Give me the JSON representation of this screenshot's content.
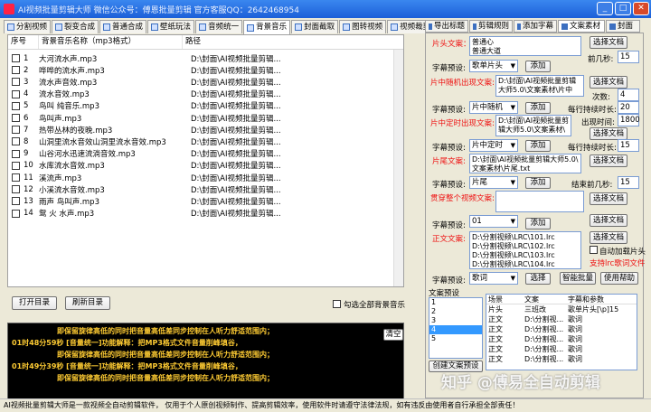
{
  "window": {
    "title": "AI视频批量剪辑大师    微信公众号：傅恩批量剪辑    官方客服QQ：2642468954"
  },
  "tabs": [
    {
      "label": "分割视频"
    },
    {
      "label": "裂变合成"
    },
    {
      "label": "普通合成"
    },
    {
      "label": "壁纸玩法"
    },
    {
      "label": "音频统一"
    },
    {
      "label": "背景音乐"
    },
    {
      "label": "封面截取"
    },
    {
      "label": "图转视频"
    },
    {
      "label": "视频裁剪"
    }
  ],
  "music_list": {
    "headers": [
      "序号",
      "背景音乐名称（mp3格式）",
      "路径"
    ],
    "rows": [
      {
        "idx": "1",
        "name": "大河流水声.mp3",
        "path": "D:\\封面\\AI视频批量剪辑..."
      },
      {
        "idx": "2",
        "name": "哗哗的流水声.mp3",
        "path": "D:\\封面\\AI视频批量剪辑..."
      },
      {
        "idx": "3",
        "name": "流水声音效.mp3",
        "path": "D:\\封面\\AI视频批量剪辑..."
      },
      {
        "idx": "4",
        "name": "流水音效.mp3",
        "path": "D:\\封面\\AI视频批量剪辑..."
      },
      {
        "idx": "5",
        "name": "鸟叫 纯音乐.mp3",
        "path": "D:\\封面\\AI视频批量剪辑..."
      },
      {
        "idx": "6",
        "name": "鸟叫声.mp3",
        "path": "D:\\封面\\AI视频批量剪辑..."
      },
      {
        "idx": "7",
        "name": "热带丛林的夜晚.mp3",
        "path": "D:\\封面\\AI视频批量剪辑..."
      },
      {
        "idx": "8",
        "name": "山洞里流水音效山洞里流水音效.mp3",
        "path": "D:\\封面\\AI视频批量剪辑..."
      },
      {
        "idx": "9",
        "name": "山谷河水迅速流淌音效.mp3",
        "path": "D:\\封面\\AI视频批量剪辑..."
      },
      {
        "idx": "10",
        "name": "水库流水音效.mp3",
        "path": "D:\\封面\\AI视频批量剪辑..."
      },
      {
        "idx": "11",
        "name": "溪流声.mp3",
        "path": "D:\\封面\\AI视频批量剪辑..."
      },
      {
        "idx": "12",
        "name": "小溪流水音效.mp3",
        "path": "D:\\封面\\AI视频批量剪辑..."
      },
      {
        "idx": "13",
        "name": "雨声 鸟叫声.mp3",
        "path": "D:\\封面\\AI视频批量剪辑..."
      },
      {
        "idx": "14",
        "name": "鸳 火 水声.mp3",
        "path": "D:\\封面\\AI视频批量剪辑..."
      }
    ]
  },
  "buttons": {
    "open_dir": "打开目录",
    "refresh_dir": "刷新目录",
    "select_all_music": "勾选全部背景音乐",
    "clear": "清空"
  },
  "console": {
    "lines": [
      "即保留旋律高低的同时把音量高低差同步控制在人听力舒适范围内；",
      "01时48分59秒 [音量统一]功能解释：把MP3格式文件音量削峰填谷，",
      "即保留旋律高低的同时把音量高低差同步控制在人听力舒适范围内；",
      "01时49分39秒 [音量统一]功能解释：把MP3格式文件音量削峰填谷，",
      "即保留旋律高低的同时把音量高低差同步控制在人听力舒适范围内；"
    ]
  },
  "status_bar": "AI视频批量剪辑大师是一款视频全自动剪辑软件，  仅用于个人原创视频制作、提高剪辑效率，使用软件时请遵守法律法规，如有违反由使用者自行承担全部责任！",
  "right_tabs": [
    {
      "label": "导出标题"
    },
    {
      "label": "剪辑规则"
    },
    {
      "label": "添加字幕"
    },
    {
      "label": "文案素材"
    },
    {
      "label": "封面"
    }
  ],
  "right": {
    "head_text_label": "片头文案：",
    "head_text": "普通心\n普通大道",
    "select_doc": "选择文档",
    "first_seconds_label": "前几秒:",
    "first_seconds": "15",
    "preset_label": "字幕预设:",
    "preset1": "歌单片头",
    "add": "添加",
    "mid_random_label": "片中随机出现文案:",
    "mid_random_text": "D:\\封面\\AI视频批量剪辑\n大师5.0\\文案素材\\片中",
    "times_label": "次数:",
    "times": "4",
    "each_dur_label": "每行持续时长:",
    "each_dur1": "20",
    "preset2": "片中随机",
    "mid_fixed_label": "片中定时出现文案:",
    "mid_fixed_text": "D:\\封面\\AI视频批量剪\n辑大师5.0\\文案素材\\",
    "show_time_label": "出现时间:",
    "show_time": "1800",
    "each_dur2": "15",
    "preset3": "片中定时",
    "tail_label": "片尾文案:",
    "tail_text": "D:\\封面\\AI视频批量剪辑大师5.0\\\n文案素材\\片尾.txt",
    "tail_seconds_label": "结束前几秒:",
    "tail_seconds": "15",
    "preset4": "片尾",
    "full_label": "贯穿整个视频文案:",
    "preset5": "01",
    "body_label": "正文文案:",
    "body_text": "D:\\分割视频\\LRC\\101.lrc\nD:\\分割视频\\LRC\\102.lrc\nD:\\分割视频\\LRC\\103.lrc\nD:\\分割视频\\LRC\\104.lrc",
    "auto_lyric": "自动加载片头",
    "lrc_note": "支持lrc歌词文件",
    "preset6": "歌词",
    "select": "选择",
    "smart_batch": "智能批量",
    "help": "使用帮助",
    "preset_list_label": "文案预设",
    "preset_items": [
      "1",
      "2",
      "3",
      "4",
      "5"
    ],
    "create_preset": "创建文案预设",
    "grid_headers": [
      "场景",
      "文案",
      "字幕和参数"
    ],
    "grid_rows": [
      [
        "片头",
        "三班改",
        "歌单片头[\\p]15"
      ],
      [
        "正文",
        "D:\\分割视...",
        "歌词"
      ],
      [
        "正文",
        "D:\\分割视...",
        "歌词"
      ],
      [
        "正文",
        "D:\\分割视...",
        "歌词"
      ],
      [
        "正文",
        "D:\\分割视...",
        "歌词"
      ],
      [
        "正文",
        "D:\\分割视...",
        "歌词"
      ]
    ]
  },
  "watermark": "知乎 @傅易全自动剪辑"
}
